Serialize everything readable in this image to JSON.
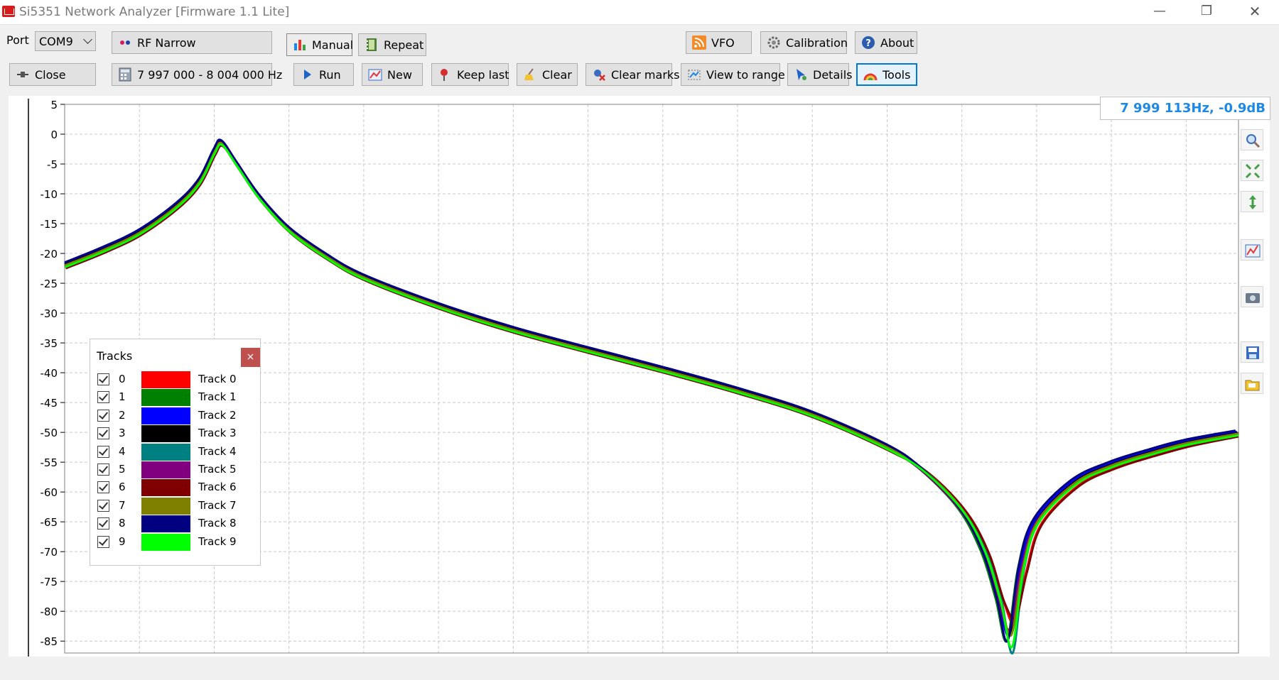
{
  "window": {
    "title": "Si5351 Network Analyzer [Firmware 1.1 Lite]",
    "minimize": "—",
    "maximize": "❐",
    "close": "✕"
  },
  "toolbar": {
    "port_label": "Port",
    "port_value": "COM9",
    "close_label": "Close",
    "mode_value": "RF Narrow",
    "range_value": "7 997 000 - 8 004 000 Hz",
    "manual_label": "Manual",
    "repeat_label": "Repeat",
    "run_label": "Run",
    "new_label": "New",
    "keep_last_label": "Keep last",
    "clear_label": "Clear",
    "clear_marks_label": "Clear marks",
    "view_to_range_label": "View to range",
    "details_label": "Details",
    "vfo_label": "VFO",
    "calibration_label": "Calibration",
    "about_label": "About",
    "tools_label": "Tools"
  },
  "readout": "7 999 113Hz, -0.9dB",
  "tracks_panel": {
    "title": "Tracks",
    "close": "×",
    "items": [
      {
        "index": "0",
        "name": "Track 0",
        "color": "#ff0000"
      },
      {
        "index": "1",
        "name": "Track 1",
        "color": "#008000"
      },
      {
        "index": "2",
        "name": "Track 2",
        "color": "#0000ff"
      },
      {
        "index": "3",
        "name": "Track 3",
        "color": "#000000"
      },
      {
        "index": "4",
        "name": "Track 4",
        "color": "#008080"
      },
      {
        "index": "5",
        "name": "Track 5",
        "color": "#800080"
      },
      {
        "index": "6",
        "name": "Track 6",
        "color": "#800000"
      },
      {
        "index": "7",
        "name": "Track 7",
        "color": "#808000"
      },
      {
        "index": "8",
        "name": "Track 8",
        "color": "#000080"
      },
      {
        "index": "9",
        "name": "Track 9",
        "color": "#00ff00"
      }
    ]
  },
  "side_tools": [
    "zoom-icon",
    "fit-icon",
    "vertical-scale-icon",
    "chart-icon",
    "camera-icon",
    "save-icon",
    "open-icon"
  ],
  "chart_data": {
    "type": "line",
    "title": "",
    "xlabel": "",
    "ylabel": "",
    "xlim": [
      7997000,
      8012700
    ],
    "ylim": [
      -87,
      5
    ],
    "grid": true,
    "x_ticks": [
      7997000,
      7998000,
      7999000,
      8000000,
      8001000,
      8002000,
      8003000,
      8004000,
      8005000,
      8006000,
      8007000,
      8008000,
      8009000,
      8010000,
      8011000,
      8012000
    ],
    "y_ticks": [
      5,
      0,
      -5,
      -10,
      -15,
      -20,
      -25,
      -30,
      -35,
      -40,
      -45,
      -50,
      -55,
      -60,
      -65,
      -70,
      -75,
      -80,
      -85
    ],
    "series": [
      {
        "name": "Track 0",
        "color": "#ff0000",
        "dx": 60,
        "dy": -0.4,
        "depth": -82
      },
      {
        "name": "Track 1",
        "color": "#008000",
        "dx": -50,
        "dy": 0.2,
        "depth": -85
      },
      {
        "name": "Track 2",
        "color": "#0000ff",
        "dx": -20,
        "dy": 0.3,
        "depth": -84
      },
      {
        "name": "Track 3",
        "color": "#000000",
        "dx": 0,
        "dy": 0.1,
        "depth": -84
      },
      {
        "name": "Track 4",
        "color": "#008080",
        "dx": 30,
        "dy": -0.1,
        "depth": -87
      },
      {
        "name": "Track 5",
        "color": "#800080",
        "dx": -10,
        "dy": -0.2,
        "depth": -83
      },
      {
        "name": "Track 6",
        "color": "#800000",
        "dx": 70,
        "dy": -0.5,
        "depth": -81
      },
      {
        "name": "Track 7",
        "color": "#808000",
        "dx": 10,
        "dy": 0.0,
        "depth": -84
      },
      {
        "name": "Track 8",
        "color": "#000080",
        "dx": -40,
        "dy": 0.5,
        "depth": -85
      },
      {
        "name": "Track 9",
        "color": "#00ff00",
        "dx": 20,
        "dy": -0.3,
        "depth": -86
      }
    ],
    "reference_shape": {
      "x": [
        7997000,
        7997500,
        7998000,
        7998500,
        7998800,
        7999000,
        7999100,
        7999300,
        7999600,
        8000000,
        8000500,
        8001000,
        8002000,
        8003000,
        8004000,
        8005000,
        8006000,
        8007000,
        8008000,
        8008500,
        8009000,
        8009300,
        8009500,
        8009650,
        8009800,
        8010000,
        8010500,
        8011000,
        8011500,
        8012000,
        8012700
      ],
      "y": [
        -22,
        -19.5,
        -16.5,
        -12,
        -8,
        -3,
        -1.5,
        -5,
        -10.5,
        -16,
        -20.5,
        -24,
        -28.8,
        -32.8,
        -36.2,
        -39.5,
        -43,
        -47,
        -52.5,
        -56.5,
        -63,
        -70,
        -78,
        -84,
        -73,
        -65,
        -58.5,
        -55.5,
        -53.5,
        -51.8,
        -50.2
      ]
    }
  }
}
